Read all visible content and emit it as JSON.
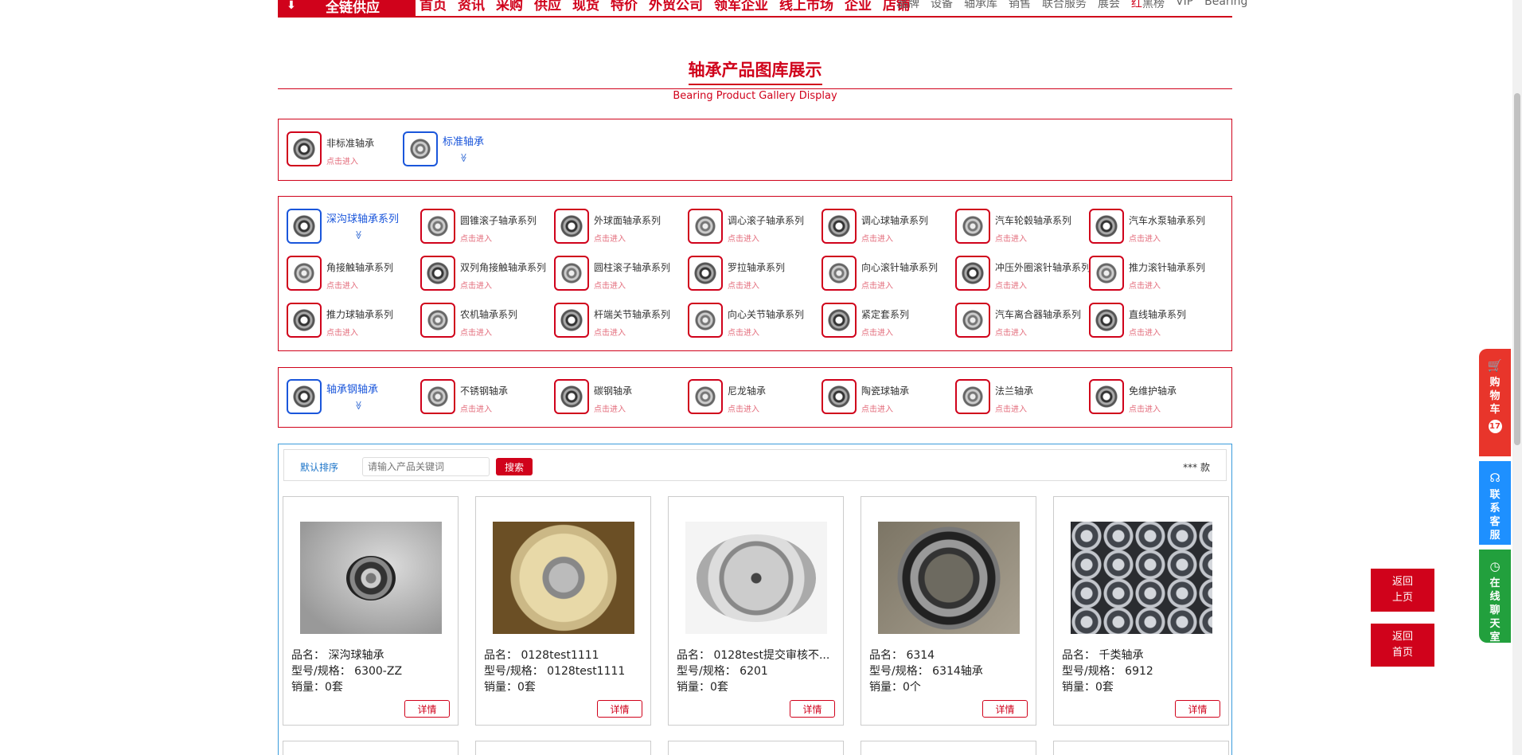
{
  "nav": {
    "supply_label": "全链供应",
    "main": [
      "首页",
      "资讯",
      "采购",
      "供应",
      "现货",
      "特价",
      "外贸公司",
      "领军企业",
      "线上市场",
      "企业",
      "店铺"
    ],
    "sub": [
      "品牌",
      "设备",
      "轴承库",
      "销售",
      "联合服务",
      "展会"
    ],
    "sub_red": "红",
    "sub_after": [
      "黑榜",
      "VIP",
      "Bearing"
    ]
  },
  "title": "轴承产品图库展示",
  "subtitle": "Bearing Product Gallery Display",
  "top_categories": [
    {
      "name": "非标准轴承",
      "hint": "点击进入"
    },
    {
      "name": "标准轴承",
      "chevron": "≫"
    }
  ],
  "series": [
    {
      "name": "深沟球轴承系列",
      "chevron": "≫"
    },
    {
      "name": "圆锥滚子轴承系列",
      "hint": "点击进入"
    },
    {
      "name": "外球面轴承系列",
      "hint": "点击进入"
    },
    {
      "name": "调心滚子轴承系列",
      "hint": "点击进入"
    },
    {
      "name": "调心球轴承系列",
      "hint": "点击进入"
    },
    {
      "name": "汽车轮毂轴承系列",
      "hint": "点击进入"
    },
    {
      "name": "汽车水泵轴承系列",
      "hint": "点击进入"
    },
    {
      "name": "角接触轴承系列",
      "hint": "点击进入"
    },
    {
      "name": "双列角接触轴承系列",
      "hint": "点击进入"
    },
    {
      "name": "圆柱滚子轴承系列",
      "hint": "点击进入"
    },
    {
      "name": "罗拉轴承系列",
      "hint": "点击进入"
    },
    {
      "name": "向心滚针轴承系列",
      "hint": "点击进入"
    },
    {
      "name": "冲压外圈滚针轴承系列",
      "hint": "点击进入"
    },
    {
      "name": "推力滚针轴承系列",
      "hint": "点击进入"
    },
    {
      "name": "推力球轴承系列",
      "hint": "点击进入"
    },
    {
      "name": "农机轴承系列",
      "hint": "点击进入"
    },
    {
      "name": "杆端关节轴承系列",
      "hint": "点击进入"
    },
    {
      "name": "向心关节轴承系列",
      "hint": "点击进入"
    },
    {
      "name": "紧定套系列",
      "hint": "点击进入"
    },
    {
      "name": "汽车离合器轴承系列",
      "hint": "点击进入"
    },
    {
      "name": "直线轴承系列",
      "hint": "点击进入"
    }
  ],
  "materials": [
    {
      "name": "轴承钢轴承",
      "chevron": "≫"
    },
    {
      "name": "不锈钢轴承",
      "hint": "点击进入"
    },
    {
      "name": "碳钢轴承",
      "hint": "点击进入"
    },
    {
      "name": "尼龙轴承",
      "hint": "点击进入"
    },
    {
      "name": "陶瓷球轴承",
      "hint": "点击进入"
    },
    {
      "name": "法兰轴承",
      "hint": "点击进入"
    },
    {
      "name": "免维护轴承",
      "hint": "点击进入"
    }
  ],
  "toolbar": {
    "sort_label": "默认排序",
    "search_placeholder": "请输入产品关键词",
    "search_button": "搜索",
    "count": "*** 款"
  },
  "products": [
    {
      "name": "品名：  深沟球轴承",
      "spec": "型号/规格：  6300-ZZ",
      "sales": "销量：0套",
      "detail": "详情"
    },
    {
      "name": "品名：  0128test1111",
      "spec": "型号/规格：  0128test1111",
      "sales": "销量：0套",
      "detail": "详情"
    },
    {
      "name": "品名：  0128test提交审核不...",
      "spec": "型号/规格：  6201",
      "sales": "销量：0套",
      "detail": "详情"
    },
    {
      "name": "品名：  6314",
      "spec": "型号/规格：  6314轴承",
      "sales": "销量：0个",
      "detail": "详情"
    },
    {
      "name": "品名：  千类轴承",
      "spec": "型号/规格：  6912",
      "sales": "销量：0套",
      "detail": "详情"
    }
  ],
  "side": {
    "cart": [
      "购",
      "物",
      "车"
    ],
    "cart_count": "17",
    "service": [
      "联",
      "系",
      "客",
      "服"
    ],
    "chat": [
      "在",
      "线",
      "聊",
      "天",
      "室"
    ],
    "back_prev": [
      "返回",
      "上页"
    ],
    "back_home": [
      "返回",
      "首页"
    ]
  },
  "colors": {
    "brand_red": "#d0021b",
    "active_blue": "#1a56db",
    "service_blue": "#1e90ff",
    "chat_green": "#22a03d"
  }
}
